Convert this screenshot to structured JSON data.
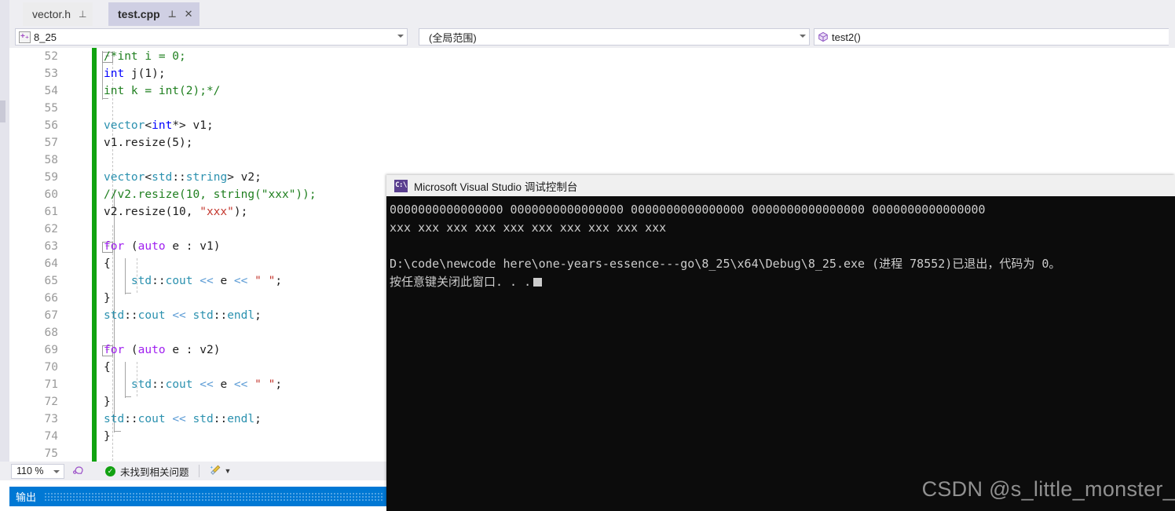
{
  "tabs": [
    {
      "label": "vector.h",
      "pin": "⊥",
      "closable": false,
      "active": false
    },
    {
      "label": "test.cpp",
      "pin": "⊥",
      "closable": true,
      "active": true
    }
  ],
  "navbar": {
    "project": "8_25",
    "project_icon": "class-add-icon",
    "scope": "(全局范围)",
    "member": "test2()",
    "member_icon": "method-cube-icon"
  },
  "editor": {
    "first_line": 52,
    "lines": [
      {
        "n": "52",
        "fold": "−",
        "code": "/*int i = 0;"
      },
      {
        "n": "53",
        "fold": "",
        "code": "int j(1);"
      },
      {
        "n": "54",
        "fold": "",
        "code": "int k = int(2);*/"
      },
      {
        "n": "55",
        "fold": "",
        "code": ""
      },
      {
        "n": "56",
        "fold": "",
        "code": "vector<int*> v1;"
      },
      {
        "n": "57",
        "fold": "",
        "code": "v1.resize(5);"
      },
      {
        "n": "58",
        "fold": "",
        "code": ""
      },
      {
        "n": "59",
        "fold": "",
        "code": "vector<std::string> v2;"
      },
      {
        "n": "60",
        "fold": "",
        "code": "//v2.resize(10, string(\"xxx\"));"
      },
      {
        "n": "61",
        "fold": "",
        "code": "v2.resize(10, \"xxx\");"
      },
      {
        "n": "62",
        "fold": "",
        "code": ""
      },
      {
        "n": "63",
        "fold": "−",
        "code": "for (auto e : v1)"
      },
      {
        "n": "64",
        "fold": "",
        "code": "{"
      },
      {
        "n": "65",
        "fold": "",
        "code": "    std::cout << e << \" \";"
      },
      {
        "n": "66",
        "fold": "",
        "code": "}"
      },
      {
        "n": "67",
        "fold": "",
        "code": "std::cout << std::endl;"
      },
      {
        "n": "68",
        "fold": "",
        "code": ""
      },
      {
        "n": "69",
        "fold": "−",
        "code": "for (auto e : v2)"
      },
      {
        "n": "70",
        "fold": "",
        "code": "{"
      },
      {
        "n": "71",
        "fold": "",
        "code": "    std::cout << e << \" \";"
      },
      {
        "n": "72",
        "fold": "",
        "code": "}"
      },
      {
        "n": "73",
        "fold": "",
        "code": "std::cout << std::endl;"
      },
      {
        "n": "74",
        "fold": "",
        "code": "}"
      },
      {
        "n": "75",
        "fold": "",
        "code": ""
      }
    ]
  },
  "statusbar": {
    "zoom": "110 %",
    "issues": "未找到相关问题",
    "ok_glyph": "✓",
    "brush_icon": "cleanup-brush-icon"
  },
  "output_panel": {
    "label": "输出"
  },
  "console": {
    "icon_text": "C:\\",
    "title": "Microsoft Visual Studio 调试控制台",
    "lines": [
      "0000000000000000 0000000000000000 0000000000000000 0000000000000000 0000000000000000",
      "xxx xxx xxx xxx xxx xxx xxx xxx xxx xxx",
      "",
      "D:\\code\\newcode here\\one-years-essence---go\\8_25\\x64\\Debug\\8_25.exe (进程 78552)已退出，代码为 0。",
      "按任意键关闭此窗口. . ."
    ]
  },
  "watermark": "CSDN @s_little_monster_",
  "colors": {
    "accent": "#0078d4",
    "change_bar": "#10a310",
    "console_bg": "#0c0c0c",
    "tab_active": "#cfcfe3",
    "chrome": "#eeeef2"
  }
}
